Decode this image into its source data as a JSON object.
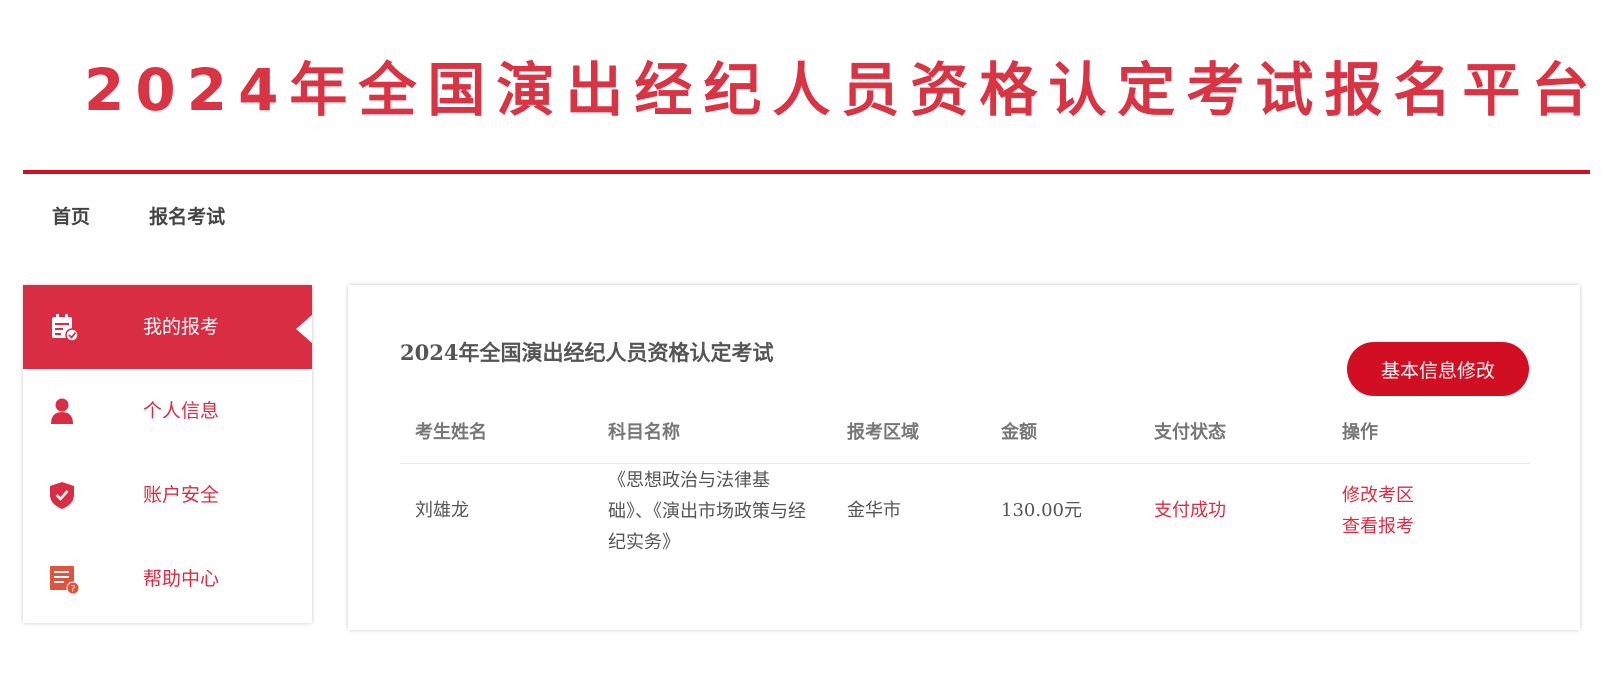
{
  "banner": {
    "title": "2024年全国演出经纪人员资格认定考试报名平台"
  },
  "nav": {
    "items": [
      {
        "label": "首页"
      },
      {
        "label": "报名考试"
      }
    ]
  },
  "sidebar": {
    "items": [
      {
        "label": "我的报考",
        "icon": "calendar-check-icon",
        "active": true
      },
      {
        "label": "个人信息",
        "icon": "user-icon",
        "active": false
      },
      {
        "label": "账户安全",
        "icon": "shield-check-icon",
        "active": false
      },
      {
        "label": "帮助中心",
        "icon": "help-document-icon",
        "active": false
      }
    ]
  },
  "main": {
    "exam_title": "2024年全国演出经纪人员资格认定考试",
    "edit_button": "基本信息修改",
    "table": {
      "headers": [
        "考生姓名",
        "科目名称",
        "报考区域",
        "金额",
        "支付状态",
        "操作"
      ],
      "rows": [
        {
          "name": "刘雄龙",
          "subject": "《思想政治与法律基础》、《演出市场政策与经纪实务》",
          "region": "金华市",
          "amount": "130.00元",
          "payment_status": "支付成功",
          "actions": [
            "修改考区",
            "查看报考"
          ]
        }
      ]
    }
  },
  "colors": {
    "brand_red": "#d20f22",
    "accent_red": "#d92d43"
  }
}
